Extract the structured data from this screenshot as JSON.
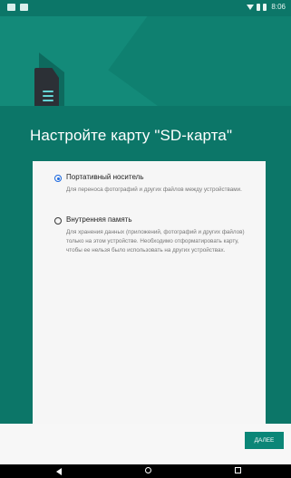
{
  "status_bar": {
    "time": "8:06",
    "left_icons": [
      "notification-icon",
      "photo-icon"
    ],
    "right_icons": [
      "wifi-icon",
      "sim-icon",
      "battery-icon"
    ]
  },
  "hero": {
    "icon": "sd-card-icon"
  },
  "screen": {
    "title": "Настройте карту \"SD-карта\""
  },
  "options": [
    {
      "title": "Портативный носитель",
      "description": "Для переноса фотографий и других файлов между устройствами.",
      "selected": true
    },
    {
      "title": "Внутренняя память",
      "description": "Для хранения данных (приложений, фотографий и других файлов) только на этом устройстве. Необходимо отформатировать карту, чтобы ее нельзя было использовать на других устройствах.",
      "selected": false
    }
  ],
  "footer": {
    "next_label": "ДАЛЕЕ"
  },
  "navigation": {
    "buttons": [
      "back-icon",
      "home-icon",
      "recents-icon"
    ]
  },
  "colors": {
    "accent": "#0b8677",
    "radio_selected": "#1c69e0",
    "panel_background": "#f6f6f6"
  }
}
